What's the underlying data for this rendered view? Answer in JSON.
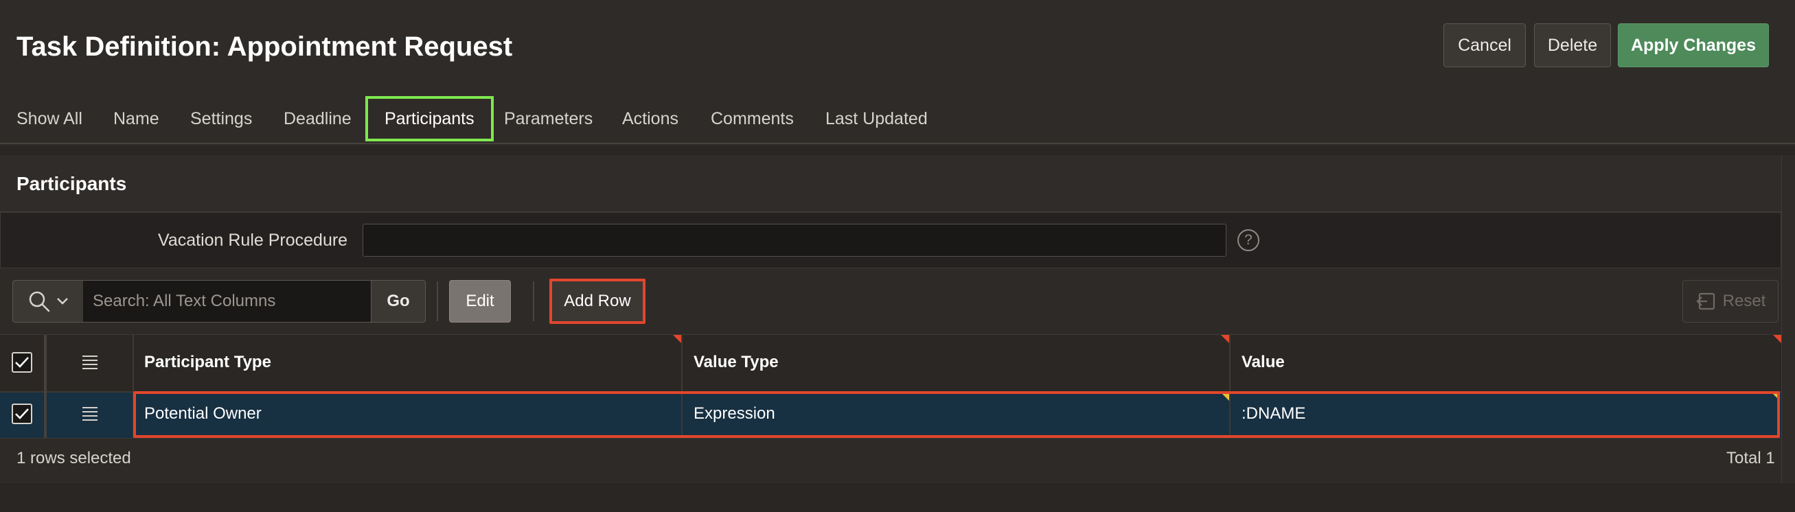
{
  "header": {
    "title": "Task Definition: Appointment Request",
    "buttons": {
      "cancel": "Cancel",
      "delete": "Delete",
      "apply": "Apply Changes"
    }
  },
  "tabs": [
    {
      "label": "Show All"
    },
    {
      "label": "Name"
    },
    {
      "label": "Settings"
    },
    {
      "label": "Deadline"
    },
    {
      "label": "Participants",
      "active": true
    },
    {
      "label": "Parameters"
    },
    {
      "label": "Actions"
    },
    {
      "label": "Comments"
    },
    {
      "label": "Last Updated"
    }
  ],
  "region": {
    "title": "Participants",
    "vacation_rule": {
      "label": "Vacation Rule Procedure",
      "value": ""
    }
  },
  "toolbar": {
    "search_icon": "magnifier-icon",
    "search_placeholder": "Search: All Text Columns",
    "go_label": "Go",
    "edit_label": "Edit",
    "add_row_label": "Add Row",
    "reset_label": "Reset"
  },
  "grid": {
    "columns": [
      "Participant Type",
      "Value Type",
      "Value"
    ],
    "rows": [
      {
        "participant_type": "Potential Owner",
        "value_type": "Expression",
        "value": ":DNAME",
        "selected": true
      }
    ]
  },
  "footer": {
    "selection": "1 rows selected",
    "total": "Total 1"
  },
  "colors": {
    "background": "#2f2b28",
    "apply_button": "#4e8a5a",
    "selected_row": "#173042",
    "highlight_red": "#e2462c",
    "highlight_green": "#7ee84f"
  }
}
